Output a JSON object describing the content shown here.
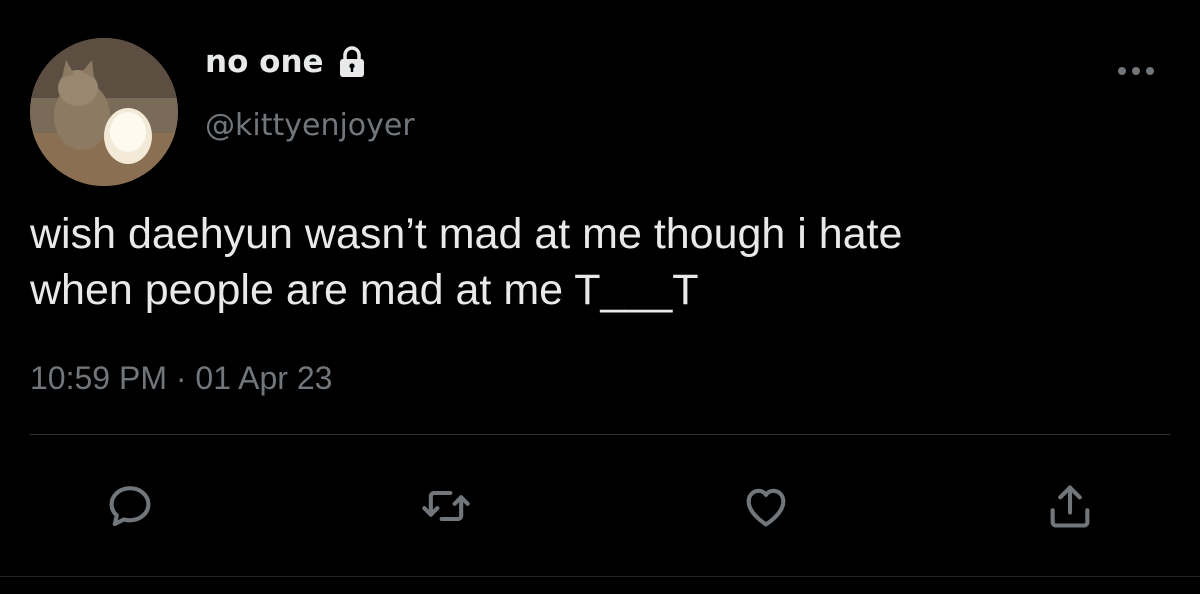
{
  "author": {
    "display_name": "no one",
    "handle": "@kittyenjoyer",
    "avatar_icon": "kitten-with-lamp-avatar",
    "protected_icon": "lock-icon"
  },
  "tweet": {
    "text": "wish daehyun wasn’t mad at me though i hate\nwhen people are mad at me T___T",
    "timestamp": "10:59 PM · 01 Apr 23"
  },
  "menu": {
    "more_icon": "more-dots-icon"
  },
  "actions": [
    {
      "name": "reply",
      "icon": "reply-icon"
    },
    {
      "name": "retweet",
      "icon": "retweet-icon"
    },
    {
      "name": "like",
      "icon": "heart-icon"
    },
    {
      "name": "share",
      "icon": "share-icon"
    }
  ],
  "colors": {
    "background": "#000000",
    "primary_text": "#e7e9ea",
    "secondary_text": "#71767b",
    "icon": "#71767b",
    "divider": "#2f3336"
  }
}
